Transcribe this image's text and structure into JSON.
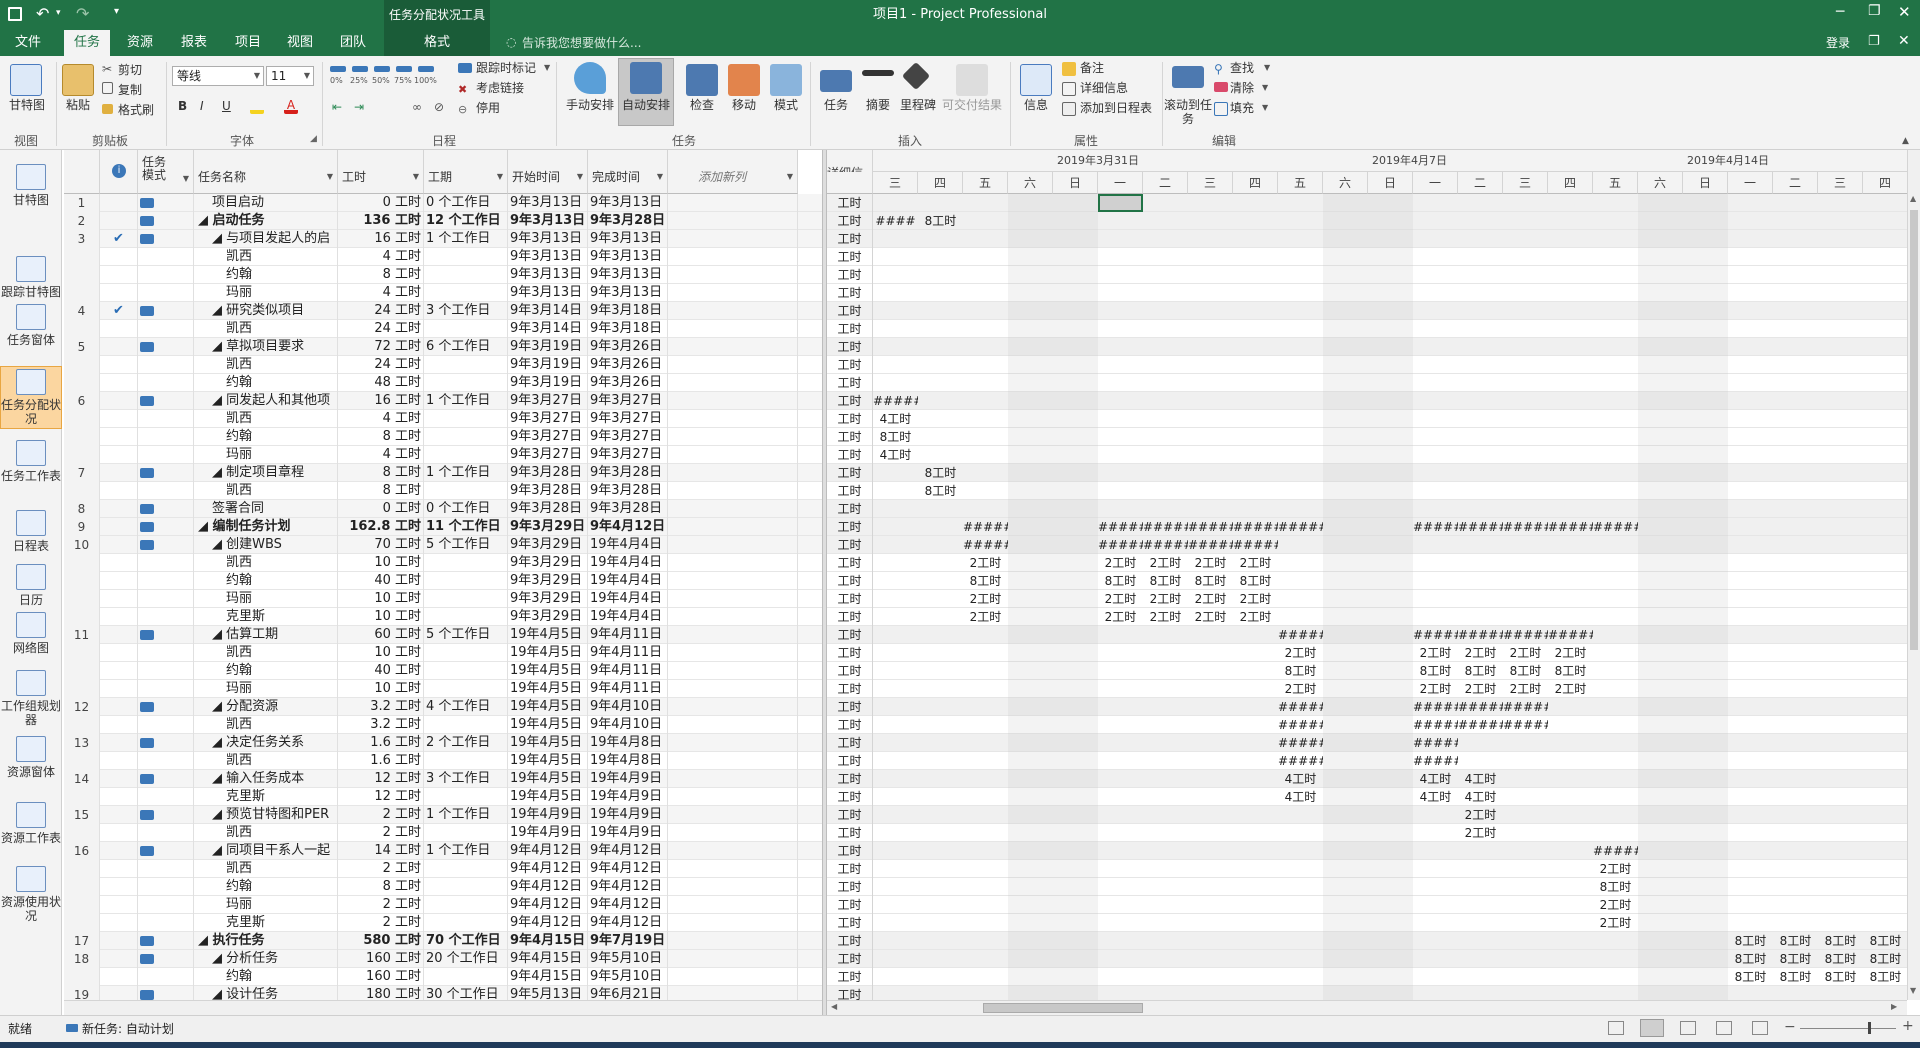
{
  "titlebar": {
    "context_group": "任务分配状况工具",
    "title": "项目1 - Project Professional",
    "login": "登录"
  },
  "tabs": [
    {
      "label": "文件"
    },
    {
      "label": "任务"
    },
    {
      "label": "资源"
    },
    {
      "label": "报表"
    },
    {
      "label": "项目"
    },
    {
      "label": "视图"
    },
    {
      "label": "团队"
    }
  ],
  "context_tab": "格式",
  "tell_me": "告诉我您想要做什么...",
  "ribbon": {
    "view": {
      "gantt": "甘特图",
      "group": "视图"
    },
    "clipboard": {
      "paste": "粘贴",
      "cut": "剪切",
      "copy": "复制",
      "format_painter": "格式刷",
      "group": "剪贴板"
    },
    "font": {
      "family": "等线",
      "size": "11",
      "bold": "B",
      "italic": "I",
      "underline": "U",
      "group": "字体"
    },
    "schedule": {
      "mark_on_track": "跟踪时标记",
      "respect_links": "考虑链接",
      "inactivate": "停用",
      "group": "日程",
      "pct": [
        "0%",
        "25%",
        "50%",
        "75%",
        "100%"
      ]
    },
    "tasks": {
      "manual": "手动安排",
      "auto": "自动安排",
      "inspect": "检查",
      "move": "移动",
      "mode": "模式",
      "group": "任务"
    },
    "insert": {
      "task": "任务",
      "summary": "摘要",
      "milestone": "里程碑",
      "deliverable": "可交付结果",
      "group": "插入"
    },
    "properties": {
      "info": "信息",
      "notes": "备注",
      "details": "详细信息",
      "add_timeline": "添加到日程表",
      "group": "属性"
    },
    "editing": {
      "scroll_to_task": "滚动到任务",
      "find": "查找",
      "clear": "清除",
      "fill": "填充",
      "group": "编辑"
    }
  },
  "leftnav": [
    {
      "label": "甘特图"
    },
    {
      "label": "跟踪甘特图"
    },
    {
      "label": "任务窗体"
    },
    {
      "label": "任务分配状况"
    },
    {
      "label": "任务工作表"
    },
    {
      "label": "日程表"
    },
    {
      "label": "日历"
    },
    {
      "label": "网络图"
    },
    {
      "label": "工作组规划器"
    },
    {
      "label": "资源窗体"
    },
    {
      "label": "资源工作表"
    },
    {
      "label": "资源使用状况"
    }
  ],
  "columns": {
    "mode": "任务模式",
    "name": "任务名称",
    "work": "工时",
    "duration": "工期",
    "start": "开始时间",
    "finish": "完成时间",
    "add": "添加新列"
  },
  "timeline": {
    "detail_label": "详细信息",
    "weeks": [
      {
        "label": "2019年3月31日"
      },
      {
        "label": "2019年4月7日"
      },
      {
        "label": "2019年4月14日"
      }
    ],
    "days": [
      "三",
      "四",
      "五",
      "六",
      "日",
      "一",
      "二",
      "三",
      "四",
      "五",
      "六",
      "日",
      "一",
      "二",
      "三",
      "四",
      "五",
      "六",
      "日",
      "一",
      "二",
      "三",
      "四"
    ]
  },
  "rows": [
    {
      "id": "1",
      "chk": "",
      "name": "项目启动",
      "indent": 1,
      "bold": false,
      "work": "0 工时",
      "dur": "0 个工作日",
      "start": "9年3月13日",
      "finish": "9年3月13日",
      "cells": {}
    },
    {
      "id": "2",
      "chk": "",
      "name": "◢ 启动任务",
      "indent": 0,
      "bold": true,
      "work": "136 工时",
      "dur": "12 个工作日",
      "start": "9年3月13日",
      "finish": "9年3月28日",
      "cells": {
        "0": "####",
        "1": "8工时"
      }
    },
    {
      "id": "3",
      "chk": "✔",
      "name": "◢ 与项目发起人的启",
      "indent": 1,
      "bold": false,
      "work": "16 工时",
      "dur": "1 个工作日",
      "start": "9年3月13日",
      "finish": "9年3月13日",
      "cells": {}
    },
    {
      "id": "",
      "chk": "",
      "name": "凯西",
      "indent": 2,
      "bold": false,
      "work": "4 工时",
      "dur": "",
      "start": "9年3月13日",
      "finish": "9年3月13日",
      "cells": {}
    },
    {
      "id": "",
      "chk": "",
      "name": "约翰",
      "indent": 2,
      "bold": false,
      "work": "8 工时",
      "dur": "",
      "start": "9年3月13日",
      "finish": "9年3月13日",
      "cells": {}
    },
    {
      "id": "",
      "chk": "",
      "name": "玛丽",
      "indent": 2,
      "bold": false,
      "work": "4 工时",
      "dur": "",
      "start": "9年3月13日",
      "finish": "9年3月13日",
      "cells": {}
    },
    {
      "id": "4",
      "chk": "✔",
      "name": "◢ 研究类似项目",
      "indent": 1,
      "bold": false,
      "work": "24 工时",
      "dur": "3 个工作日",
      "start": "9年3月14日",
      "finish": "9年3月18日",
      "cells": {}
    },
    {
      "id": "",
      "chk": "",
      "name": "凯西",
      "indent": 2,
      "bold": false,
      "work": "24 工时",
      "dur": "",
      "start": "9年3月14日",
      "finish": "9年3月18日",
      "cells": {}
    },
    {
      "id": "5",
      "chk": "",
      "name": "◢ 草拟项目要求",
      "indent": 1,
      "bold": false,
      "work": "72 工时",
      "dur": "6 个工作日",
      "start": "9年3月19日",
      "finish": "9年3月26日",
      "cells": {}
    },
    {
      "id": "",
      "chk": "",
      "name": "凯西",
      "indent": 2,
      "bold": false,
      "work": "24 工时",
      "dur": "",
      "start": "9年3月19日",
      "finish": "9年3月26日",
      "cells": {}
    },
    {
      "id": "",
      "chk": "",
      "name": "约翰",
      "indent": 2,
      "bold": false,
      "work": "48 工时",
      "dur": "",
      "start": "9年3月19日",
      "finish": "9年3月26日",
      "cells": {}
    },
    {
      "id": "6",
      "chk": "",
      "name": "◢ 同发起人和其他项",
      "indent": 1,
      "bold": false,
      "work": "16 工时",
      "dur": "1 个工作日",
      "start": "9年3月27日",
      "finish": "9年3月27日",
      "cells": {
        "0": "#####"
      }
    },
    {
      "id": "",
      "chk": "",
      "name": "凯西",
      "indent": 2,
      "bold": false,
      "work": "4 工时",
      "dur": "",
      "start": "9年3月27日",
      "finish": "9年3月27日",
      "cells": {
        "0": "4工时"
      }
    },
    {
      "id": "",
      "chk": "",
      "name": "约翰",
      "indent": 2,
      "bold": false,
      "work": "8 工时",
      "dur": "",
      "start": "9年3月27日",
      "finish": "9年3月27日",
      "cells": {
        "0": "8工时"
      }
    },
    {
      "id": "",
      "chk": "",
      "name": "玛丽",
      "indent": 2,
      "bold": false,
      "work": "4 工时",
      "dur": "",
      "start": "9年3月27日",
      "finish": "9年3月27日",
      "cells": {
        "0": "4工时"
      }
    },
    {
      "id": "7",
      "chk": "",
      "name": "◢ 制定项目章程",
      "indent": 1,
      "bold": false,
      "work": "8 工时",
      "dur": "1 个工作日",
      "start": "9年3月28日",
      "finish": "9年3月28日",
      "cells": {
        "1": "8工时"
      }
    },
    {
      "id": "",
      "chk": "",
      "name": "凯西",
      "indent": 2,
      "bold": false,
      "work": "8 工时",
      "dur": "",
      "start": "9年3月28日",
      "finish": "9年3月28日",
      "cells": {
        "1": "8工时"
      }
    },
    {
      "id": "8",
      "chk": "",
      "name": "签署合同",
      "indent": 1,
      "bold": false,
      "work": "0 工时",
      "dur": "0 个工作日",
      "start": "9年3月28日",
      "finish": "9年3月28日",
      "cells": {}
    },
    {
      "id": "9",
      "chk": "",
      "name": "◢ 编制任务计划",
      "indent": 0,
      "bold": true,
      "work": "162.8 工时",
      "dur": "11 个工作日",
      "start": "9年3月29日",
      "finish": "9年4月12日",
      "cells": {
        "2": "#####",
        "5": "#####",
        "6": "#####",
        "7": "#####",
        "8": "#####",
        "9": "#####",
        "12": "#####",
        "13": "#####",
        "14": "#####",
        "15": "#####",
        "16": "#####"
      }
    },
    {
      "id": "10",
      "chk": "",
      "name": "◢ 创建WBS",
      "indent": 1,
      "bold": false,
      "work": "70 工时",
      "dur": "5 个工作日",
      "start": "9年3月29日",
      "finish": "19年4月4日",
      "cells": {
        "2": "#####",
        "5": "#####",
        "6": "#####",
        "7": "#####",
        "8": "#####"
      }
    },
    {
      "id": "",
      "chk": "",
      "name": "凯西",
      "indent": 2,
      "bold": false,
      "work": "10 工时",
      "dur": "",
      "start": "9年3月29日",
      "finish": "19年4月4日",
      "cells": {
        "2": "2工时",
        "5": "2工时",
        "6": "2工时",
        "7": "2工时",
        "8": "2工时"
      }
    },
    {
      "id": "",
      "chk": "",
      "name": "约翰",
      "indent": 2,
      "bold": false,
      "work": "40 工时",
      "dur": "",
      "start": "9年3月29日",
      "finish": "19年4月4日",
      "cells": {
        "2": "8工时",
        "5": "8工时",
        "6": "8工时",
        "7": "8工时",
        "8": "8工时"
      }
    },
    {
      "id": "",
      "chk": "",
      "name": "玛丽",
      "indent": 2,
      "bold": false,
      "work": "10 工时",
      "dur": "",
      "start": "9年3月29日",
      "finish": "19年4月4日",
      "cells": {
        "2": "2工时",
        "5": "2工时",
        "6": "2工时",
        "7": "2工时",
        "8": "2工时"
      }
    },
    {
      "id": "",
      "chk": "",
      "name": "克里斯",
      "indent": 2,
      "bold": false,
      "work": "10 工时",
      "dur": "",
      "start": "9年3月29日",
      "finish": "19年4月4日",
      "cells": {
        "2": "2工时",
        "5": "2工时",
        "6": "2工时",
        "7": "2工时",
        "8": "2工时"
      }
    },
    {
      "id": "11",
      "chk": "",
      "name": "◢ 估算工期",
      "indent": 1,
      "bold": false,
      "work": "60 工时",
      "dur": "5 个工作日",
      "start": "19年4月5日",
      "finish": "9年4月11日",
      "cells": {
        "9": "#####",
        "12": "#####",
        "13": "#####",
        "14": "#####",
        "15": "#####"
      }
    },
    {
      "id": "",
      "chk": "",
      "name": "凯西",
      "indent": 2,
      "bold": false,
      "work": "10 工时",
      "dur": "",
      "start": "19年4月5日",
      "finish": "9年4月11日",
      "cells": {
        "9": "2工时",
        "12": "2工时",
        "13": "2工时",
        "14": "2工时",
        "15": "2工时"
      }
    },
    {
      "id": "",
      "chk": "",
      "name": "约翰",
      "indent": 2,
      "bold": false,
      "work": "40 工时",
      "dur": "",
      "start": "19年4月5日",
      "finish": "9年4月11日",
      "cells": {
        "9": "8工时",
        "12": "8工时",
        "13": "8工时",
        "14": "8工时",
        "15": "8工时"
      }
    },
    {
      "id": "",
      "chk": "",
      "name": "玛丽",
      "indent": 2,
      "bold": false,
      "work": "10 工时",
      "dur": "",
      "start": "19年4月5日",
      "finish": "9年4月11日",
      "cells": {
        "9": "2工时",
        "12": "2工时",
        "13": "2工时",
        "14": "2工时",
        "15": "2工时"
      }
    },
    {
      "id": "12",
      "chk": "",
      "name": "◢ 分配资源",
      "indent": 1,
      "bold": false,
      "work": "3.2 工时",
      "dur": "4 个工作日",
      "start": "19年4月5日",
      "finish": "9年4月10日",
      "cells": {
        "9": "#####",
        "12": "#####",
        "13": "#####",
        "14": "#####"
      }
    },
    {
      "id": "",
      "chk": "",
      "name": "凯西",
      "indent": 2,
      "bold": false,
      "work": "3.2 工时",
      "dur": "",
      "start": "19年4月5日",
      "finish": "9年4月10日",
      "cells": {
        "9": "#####",
        "12": "#####",
        "13": "#####",
        "14": "#####"
      }
    },
    {
      "id": "13",
      "chk": "",
      "name": "◢ 决定任务关系",
      "indent": 1,
      "bold": false,
      "work": "1.6 工时",
      "dur": "2 个工作日",
      "start": "19年4月5日",
      "finish": "19年4月8日",
      "cells": {
        "9": "#####",
        "12": "#####"
      }
    },
    {
      "id": "",
      "chk": "",
      "name": "凯西",
      "indent": 2,
      "bold": false,
      "work": "1.6 工时",
      "dur": "",
      "start": "19年4月5日",
      "finish": "19年4月8日",
      "cells": {
        "9": "#####",
        "12": "#####"
      }
    },
    {
      "id": "14",
      "chk": "",
      "name": "◢ 输入任务成本",
      "indent": 1,
      "bold": false,
      "work": "12 工时",
      "dur": "3 个工作日",
      "start": "19年4月5日",
      "finish": "19年4月9日",
      "cells": {
        "9": "4工时",
        "12": "4工时",
        "13": "4工时"
      }
    },
    {
      "id": "",
      "chk": "",
      "name": "克里斯",
      "indent": 2,
      "bold": false,
      "work": "12 工时",
      "dur": "",
      "start": "19年4月5日",
      "finish": "19年4月9日",
      "cells": {
        "9": "4工时",
        "12": "4工时",
        "13": "4工时"
      }
    },
    {
      "id": "15",
      "chk": "",
      "name": "◢ 预览甘特图和PER",
      "indent": 1,
      "bold": false,
      "work": "2 工时",
      "dur": "1 个工作日",
      "start": "19年4月9日",
      "finish": "19年4月9日",
      "cells": {
        "13": "2工时"
      }
    },
    {
      "id": "",
      "chk": "",
      "name": "凯西",
      "indent": 2,
      "bold": false,
      "work": "2 工时",
      "dur": "",
      "start": "19年4月9日",
      "finish": "19年4月9日",
      "cells": {
        "13": "2工时"
      }
    },
    {
      "id": "16",
      "chk": "",
      "name": "◢ 同项目干系人一起",
      "indent": 1,
      "bold": false,
      "work": "14 工时",
      "dur": "1 个工作日",
      "start": "9年4月12日",
      "finish": "9年4月12日",
      "cells": {
        "16": "#####"
      }
    },
    {
      "id": "",
      "chk": "",
      "name": "凯西",
      "indent": 2,
      "bold": false,
      "work": "2 工时",
      "dur": "",
      "start": "9年4月12日",
      "finish": "9年4月12日",
      "cells": {
        "16": "2工时"
      }
    },
    {
      "id": "",
      "chk": "",
      "name": "约翰",
      "indent": 2,
      "bold": false,
      "work": "8 工时",
      "dur": "",
      "start": "9年4月12日",
      "finish": "9年4月12日",
      "cells": {
        "16": "8工时"
      }
    },
    {
      "id": "",
      "chk": "",
      "name": "玛丽",
      "indent": 2,
      "bold": false,
      "work": "2 工时",
      "dur": "",
      "start": "9年4月12日",
      "finish": "9年4月12日",
      "cells": {
        "16": "2工时"
      }
    },
    {
      "id": "",
      "chk": "",
      "name": "克里斯",
      "indent": 2,
      "bold": false,
      "work": "2 工时",
      "dur": "",
      "start": "9年4月12日",
      "finish": "9年4月12日",
      "cells": {
        "16": "2工时"
      }
    },
    {
      "id": "17",
      "chk": "",
      "name": "◢ 执行任务",
      "indent": 0,
      "bold": true,
      "work": "580 工时",
      "dur": "70 个工作日",
      "start": "9年4月15日",
      "finish": "9年7月19日",
      "cells": {
        "19": "8工时",
        "20": "8工时",
        "21": "8工时",
        "22": "8工时"
      }
    },
    {
      "id": "18",
      "chk": "",
      "name": "◢ 分析任务",
      "indent": 1,
      "bold": false,
      "work": "160 工时",
      "dur": "20 个工作日",
      "start": "9年4月15日",
      "finish": "9年5月10日",
      "cells": {
        "19": "8工时",
        "20": "8工时",
        "21": "8工时",
        "22": "8工时"
      }
    },
    {
      "id": "",
      "chk": "",
      "name": "约翰",
      "indent": 2,
      "bold": false,
      "work": "160 工时",
      "dur": "",
      "start": "9年4月15日",
      "finish": "9年5月10日",
      "cells": {
        "19": "8工时",
        "20": "8工时",
        "21": "8工时",
        "22": "8工时"
      }
    },
    {
      "id": "19",
      "chk": "",
      "name": "◢ 设计任务",
      "indent": 1,
      "bold": false,
      "work": "180 工时",
      "dur": "30 个工作日",
      "start": "9年5月13日",
      "finish": "9年6月21日",
      "cells": {}
    }
  ],
  "row_unit": "工时",
  "status": {
    "ready": "就绪",
    "new_task": "新任务: 自动计划"
  }
}
